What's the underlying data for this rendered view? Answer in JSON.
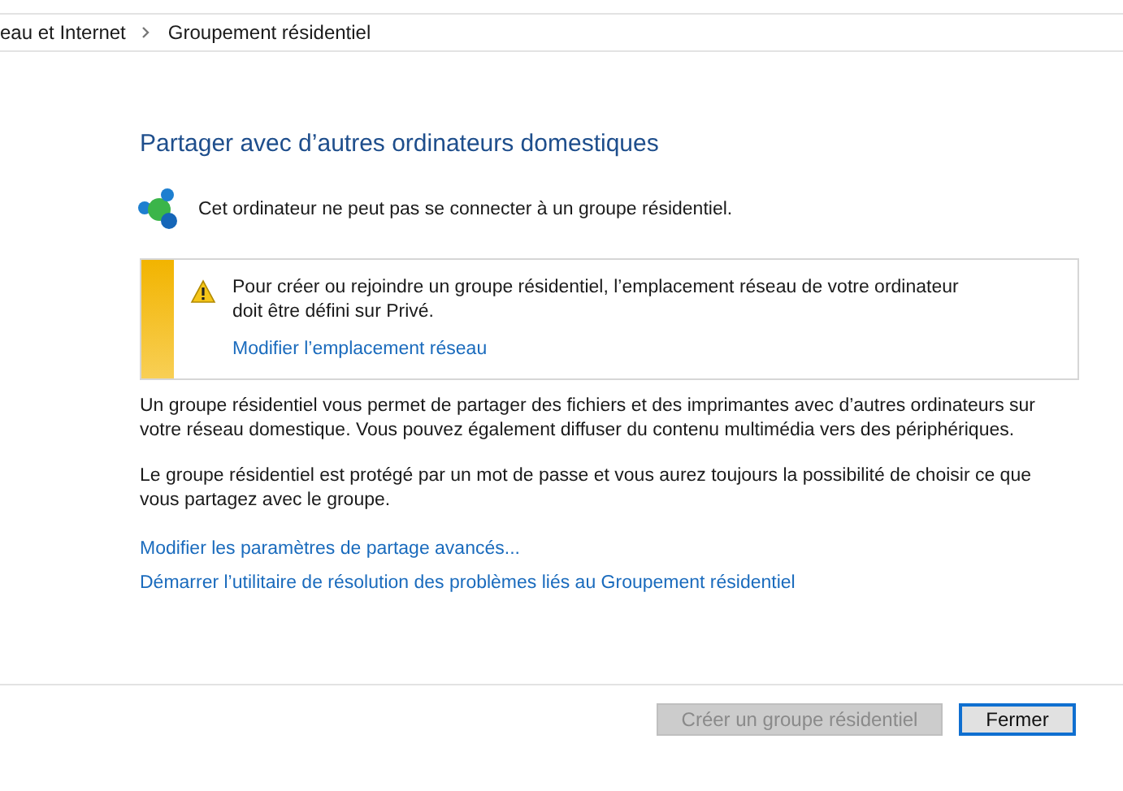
{
  "breadcrumb": [
    "eau et Internet",
    "Groupement résidentiel"
  ],
  "title": "Partager avec d’autres ordinateurs domestiques",
  "status": "Cet ordinateur ne peut pas se connecter à un groupe résidentiel.",
  "warning": {
    "text": "Pour créer ou rejoindre un groupe résidentiel, l’emplacement réseau de votre ordinateur doit être défini sur Privé.",
    "link": "Modifier l’emplacement réseau"
  },
  "paragraphs": [
    "Un groupe résidentiel vous permet de partager des fichiers et des imprimantes avec d’autres ordinateurs sur votre réseau domestique. Vous pouvez également diffuser du contenu multimédia vers des périphériques.",
    "Le groupe résidentiel est protégé par un mot de passe et vous aurez toujours la possibilité de choisir ce que vous partagez avec le groupe."
  ],
  "links": [
    "Modifier les paramètres de partage avancés...",
    "Démarrer l’utilitaire de résolution des problèmes liés au Groupement résidentiel"
  ],
  "buttons": [
    {
      "label": "Créer un groupe résidentiel",
      "disabled": true,
      "focused": false
    },
    {
      "label": "Fermer",
      "disabled": false,
      "focused": true
    }
  ]
}
